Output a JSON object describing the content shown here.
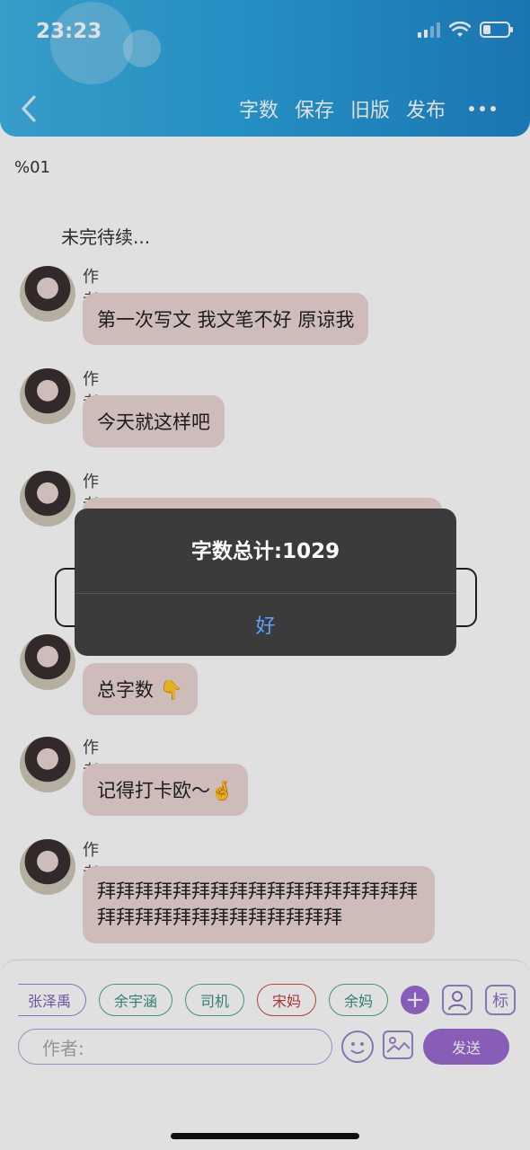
{
  "status_bar": {
    "time": "23:23"
  },
  "nav": {
    "actions": [
      "字数",
      "保存",
      "旧版",
      "发布"
    ]
  },
  "content": {
    "percent": "%01",
    "pending": "未完待续...",
    "messages": [
      {
        "author": "作者",
        "text": "第一次写文 我文笔不好 原谅我"
      },
      {
        "author": "作者",
        "text": "今天就这样吧"
      },
      {
        "author": "作者",
        "text": ""
      },
      {
        "author": "",
        "text": "总字数 👇"
      },
      {
        "author": "作者",
        "text": "记得打卡欧～🤞"
      },
      {
        "author": "作者",
        "text": "拜拜拜拜拜拜拜拜拜拜拜拜拜拜拜拜拜拜拜拜拜拜拜拜拜拜拜拜拜拜"
      }
    ]
  },
  "input": {
    "tags": [
      "张泽禹",
      "余宇涵",
      "司机",
      "宋妈",
      "余妈"
    ],
    "plus": "+",
    "tag_icon_label": "标",
    "author_placeholder": "作者:",
    "send_label": "发送"
  },
  "alert": {
    "title": "字数总计:1029",
    "button": "好"
  },
  "colors": {
    "header_start": "#3fb2e4",
    "header_end": "#1f86c9",
    "bubble": "#ead7d4",
    "accent_purple": "#9b6ad1",
    "alert_bg": "#3b3b3c",
    "alert_button": "#5aa3ff"
  }
}
